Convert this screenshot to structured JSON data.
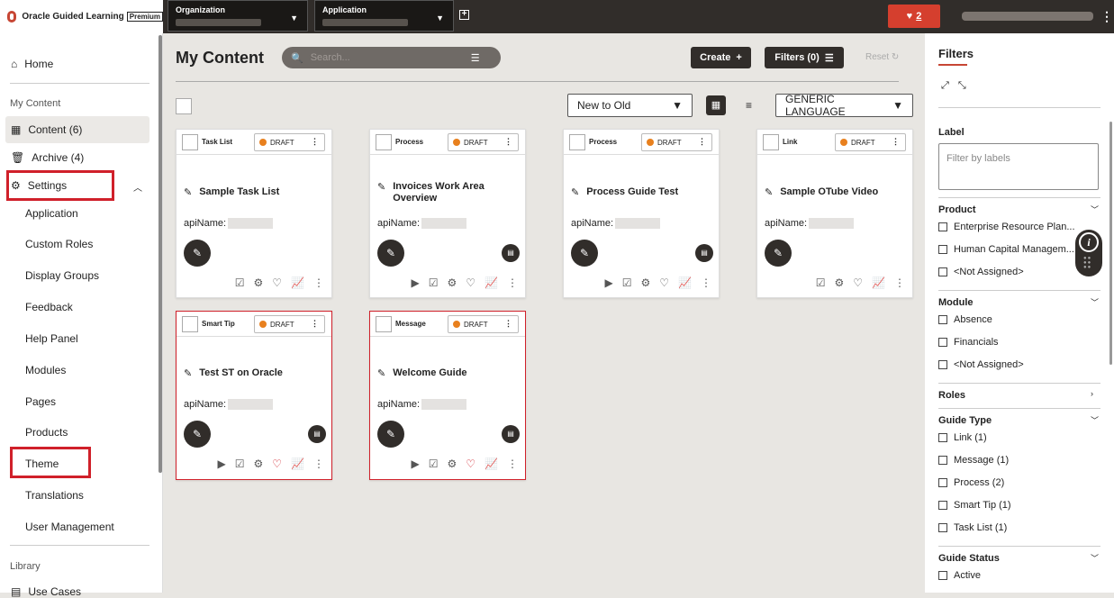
{
  "header": {
    "brand": "Oracle Guided Learning",
    "badge": "Premium",
    "organization_label": "Organization",
    "application_label": "Application",
    "notifications_count": "2"
  },
  "sidebar": {
    "home": "Home",
    "my_content_section": "My Content",
    "content": "Content (6)",
    "archive": "Archive (4)",
    "settings": "Settings",
    "settings_items": [
      "Application",
      "Custom Roles",
      "Display Groups",
      "Feedback",
      "Help Panel",
      "Modules",
      "Pages",
      "Products",
      "Theme",
      "Translations",
      "User Management"
    ],
    "library_section": "Library",
    "use_cases": "Use Cases"
  },
  "main": {
    "title": "My Content",
    "search_placeholder": "Search...",
    "create_label": "Create",
    "filters_label": "Filters (0)",
    "reset_label": "Reset",
    "sort_value": "New to Old",
    "language_value": "GENERIC LANGUAGE"
  },
  "cards": [
    {
      "type": "Task List",
      "status": "DRAFT",
      "title": "Sample Task List",
      "api_label": "apiName:"
    },
    {
      "type": "Process",
      "status": "DRAFT",
      "title": "Invoices Work Area Overview",
      "api_label": "apiName:"
    },
    {
      "type": "Process",
      "status": "DRAFT",
      "title": "Process Guide Test",
      "api_label": "apiName:"
    },
    {
      "type": "Link",
      "status": "DRAFT",
      "title": "Sample OTube Video",
      "api_label": "apiName:"
    },
    {
      "type": "Smart Tip",
      "status": "DRAFT",
      "title": "Test ST on Oracle",
      "api_label": "apiName:"
    },
    {
      "type": "Message",
      "status": "DRAFT",
      "title": "Welcome Guide",
      "api_label": "apiName:"
    }
  ],
  "filters": {
    "title": "Filters",
    "label_heading": "Label",
    "label_placeholder": "Filter by labels",
    "product_heading": "Product",
    "product_options": [
      "Enterprise Resource Plan...",
      "Human Capital Managem...",
      "<Not Assigned>"
    ],
    "module_heading": "Module",
    "module_options": [
      "Absence",
      "Financials",
      "<Not Assigned>"
    ],
    "roles_heading": "Roles",
    "guide_type_heading": "Guide Type",
    "guide_type_options": [
      "Link (1)",
      "Message (1)",
      "Process (2)",
      "Smart Tip (1)",
      "Task List (1)"
    ],
    "guide_status_heading": "Guide Status",
    "guide_status_options": [
      "Active"
    ]
  },
  "colors": {
    "accent": "#c74634",
    "highlight": "#d0202a",
    "dark": "#312d2a",
    "draft_dot": "#e8801e"
  }
}
